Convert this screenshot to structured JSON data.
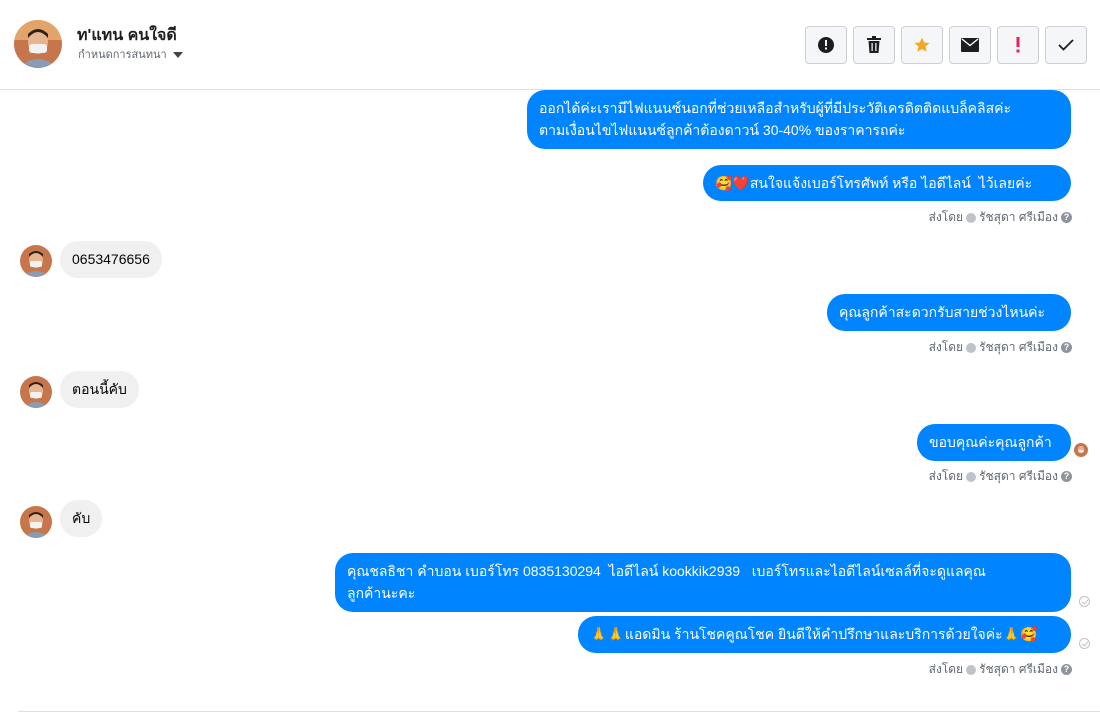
{
  "header": {
    "contact_name": "ท'แทน คนใจดี",
    "label_selector": "กำหนดการสนทนา",
    "accent_color": "#0084ff",
    "actions": [
      {
        "icon": "alert-circle-icon",
        "name": "report-button"
      },
      {
        "icon": "trash-icon",
        "name": "delete-button"
      },
      {
        "icon": "star-icon",
        "name": "star-button"
      },
      {
        "icon": "envelope-icon",
        "name": "mark-unread-button"
      },
      {
        "icon": "exclamation-icon",
        "name": "follow-up-button"
      },
      {
        "icon": "checkmark-icon",
        "name": "mark-done-button"
      }
    ]
  },
  "messages": {
    "m1": "ออกได้ค่ะเรามีไฟแนนซ์นอกที่ช่วยเหลือสำหรับผู้ที่มีประวัติเครดิตติดแบล็คลิสค่ะ\nตามเงื่อนไขไฟแนนซ์ลูกค้าต้องดาวน์ 30-40% ของราคารถค่ะ",
    "m2": "🥰❤️สนใจแจ้งเบอร์โทรศัพท์ หรือ ไอดีไลน์  ไว้เลยค่ะ",
    "m3": "0653476656",
    "m4": "คุณลูกค้าสะดวกรับสายช่วงไหนค่ะ",
    "m5": "ตอนนี้คับ",
    "m6": "ขอบคุณค่ะคุณลูกค้า",
    "m7": "คับ",
    "m8": "คุณชลธิชา คำบอน เบอร์โทร 0835130294  ไอดีไลน์ kookkik2939   เบอร์โทรและไอดีไลน์เซลล์ที่จะดูแลคุณ\nลูกค้านะคะ",
    "m9": "🙏🙏แอดมิน ร้านโชคคูณโชค ยินดีให้คำปรึกษาและบริการด้วยใจค่ะ🙏🥰"
  },
  "sent_by": {
    "prefix": "ส่งโดย",
    "agent": "รัชสุดา ศรีเมือง",
    "help": "?"
  }
}
